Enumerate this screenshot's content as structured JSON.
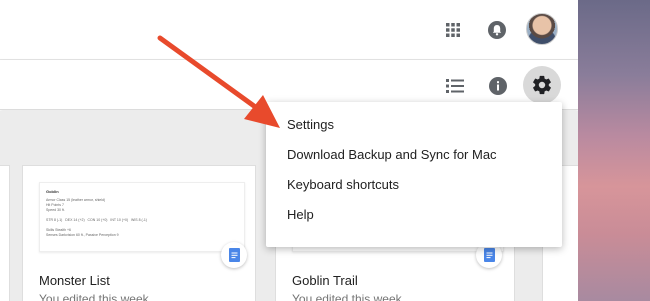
{
  "toolbar": {
    "apps_icon": "apps-grid-icon",
    "notifications_icon": "notifications-bell-icon",
    "view_icon": "list-view-icon",
    "info_icon": "info-icon",
    "settings_icon": "gear-icon"
  },
  "settings_menu": {
    "items": [
      {
        "label": "Settings"
      },
      {
        "label": "Download Backup and Sync for Mac"
      },
      {
        "label": "Keyboard shortcuts"
      },
      {
        "label": "Help"
      }
    ]
  },
  "files": [
    {
      "title": "Monster List",
      "subtitle": "You edited this week",
      "icon": "docs-icon"
    },
    {
      "title": "Goblin Trail",
      "subtitle": "You edited this week",
      "icon": "docs-icon"
    }
  ],
  "colors": {
    "arrow": "#e84a2c",
    "docs_blue": "#4a86e8",
    "gear_bg": "#d9d9d9"
  }
}
